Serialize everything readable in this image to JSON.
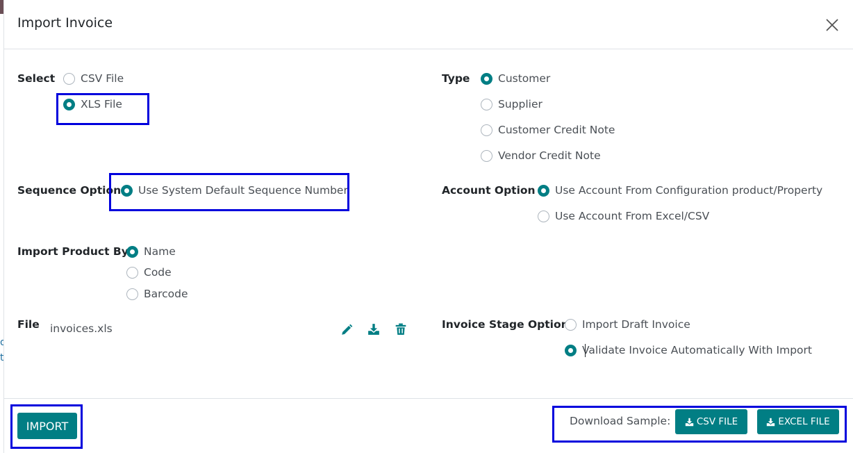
{
  "dialog": {
    "title": "Import Invoice",
    "close_icon": "close-icon"
  },
  "select": {
    "label": "Select",
    "options": [
      {
        "label": "CSV File",
        "checked": false
      },
      {
        "label": "XLS File",
        "checked": true
      }
    ]
  },
  "type": {
    "label": "Type",
    "options": [
      {
        "label": "Customer",
        "checked": true
      },
      {
        "label": "Supplier",
        "checked": false
      },
      {
        "label": "Customer Credit Note",
        "checked": false
      },
      {
        "label": "Vendor Credit Note",
        "checked": false
      }
    ]
  },
  "sequence": {
    "label": "Sequence Option",
    "options": [
      {
        "label": "Use System Default Sequence Number",
        "checked": true
      }
    ]
  },
  "account": {
    "label": "Account Option",
    "options": [
      {
        "label": "Use Account From Configuration product/Property",
        "checked": true
      },
      {
        "label": "Use Account From Excel/CSV",
        "checked": false
      }
    ]
  },
  "product": {
    "label": "Import Product By",
    "options": [
      {
        "label": "Name",
        "checked": true
      },
      {
        "label": "Code",
        "checked": false
      },
      {
        "label": "Barcode",
        "checked": false
      }
    ]
  },
  "file": {
    "label": "File",
    "value": "invoices.xls",
    "icons": [
      "pencil-icon",
      "download-icon",
      "trash-icon"
    ]
  },
  "stage": {
    "label": "Invoice Stage Option",
    "options": [
      {
        "label": "Import Draft Invoice",
        "checked": false
      },
      {
        "label": "Validate Invoice Automatically With Import",
        "checked": true
      }
    ]
  },
  "footer": {
    "import_label": "IMPORT",
    "download_sample_label": "Download Sample:",
    "csv_label": "CSV FILE",
    "excel_label": "EXCEL FILE"
  },
  "colors": {
    "primary": "#017e84",
    "highlight": "#0000dd"
  }
}
